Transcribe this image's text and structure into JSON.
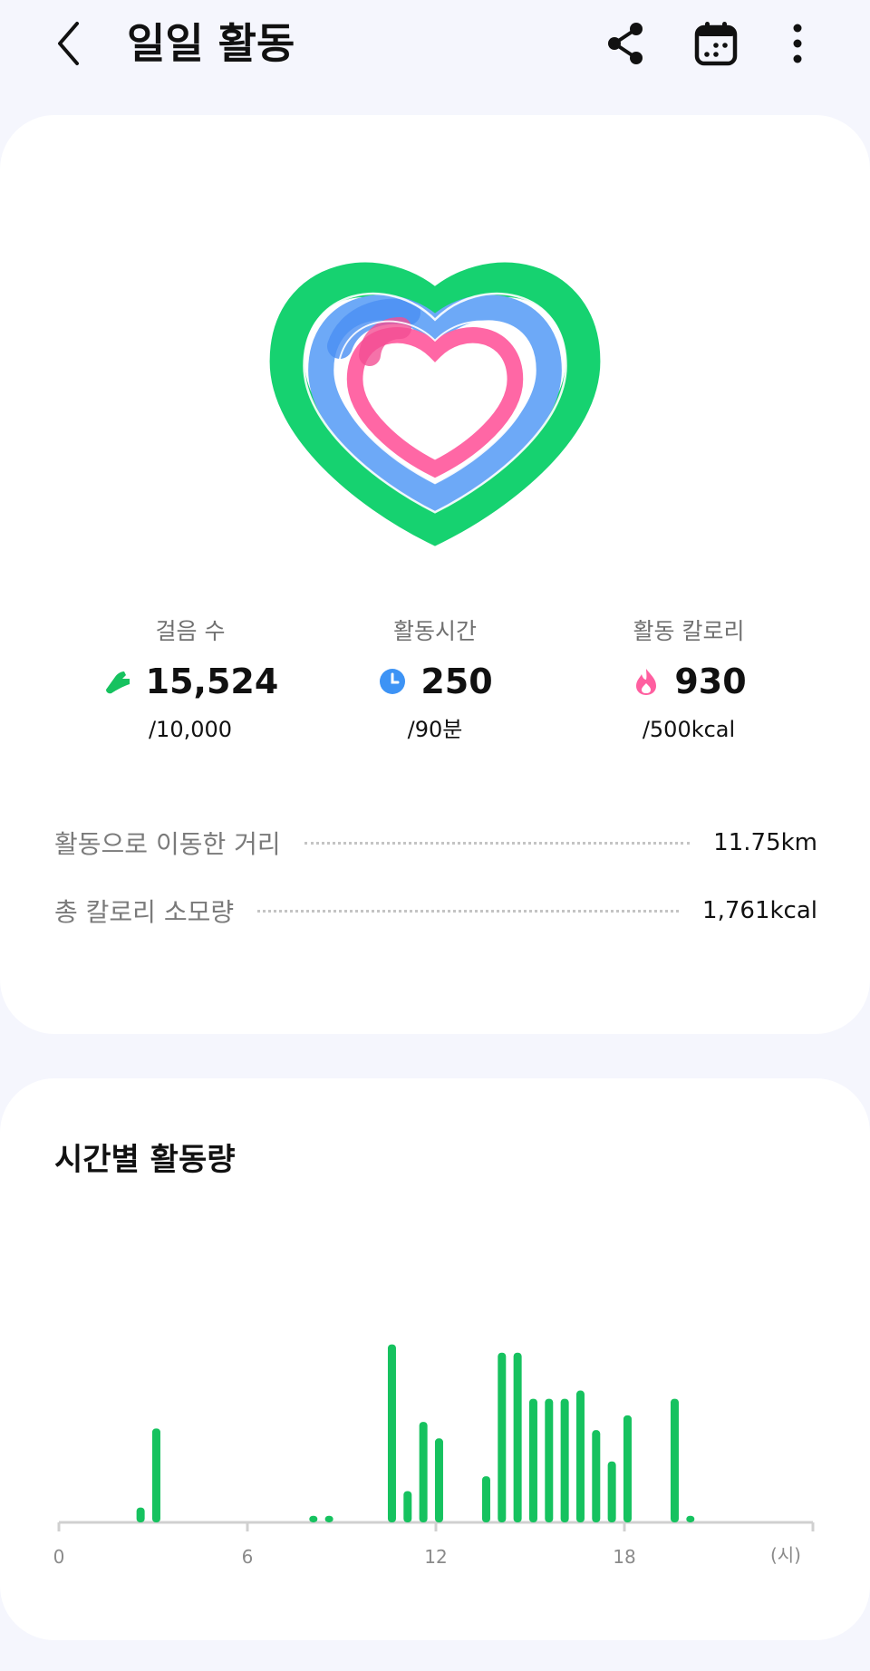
{
  "header": {
    "title": "일일 활동",
    "icons": [
      "back-arrow-icon",
      "share-icon",
      "calendar-icon",
      "more-vertical-icon"
    ]
  },
  "summary": {
    "metrics": [
      {
        "label": "걸음 수",
        "value": "15,524",
        "goal": "/10,000",
        "icon": "shoe-icon",
        "color": "#16c25f"
      },
      {
        "label": "활동시간",
        "value": "250",
        "goal": "/90분",
        "icon": "clock-icon",
        "color": "#3d93f5"
      },
      {
        "label": "활동 칼로리",
        "value": "930",
        "goal": "/500kcal",
        "icon": "flame-icon",
        "color": "#ff5fa0"
      }
    ],
    "stats": [
      {
        "label": "활동으로 이동한 거리",
        "value": "11.75km"
      },
      {
        "label": "총 칼로리 소모량",
        "value": "1,761kcal"
      }
    ]
  },
  "chart_data": {
    "type": "bar",
    "title": "시간별 활동량",
    "x_unit": "(시)",
    "x_ticks": [
      "0",
      "6",
      "12",
      "18"
    ],
    "xlim": [
      0,
      24
    ],
    "ylim": [
      0,
      11
    ],
    "color": "#16c25f",
    "x": [
      2.6,
      3.1,
      8.1,
      8.6,
      10.6,
      11.1,
      11.6,
      12.1,
      13.6,
      14.1,
      14.6,
      15.1,
      15.6,
      16.1,
      16.6,
      17.1,
      17.6,
      18.1,
      19.6,
      20.1
    ],
    "values": [
      0.9,
      5.7,
      0.4,
      0.4,
      10.8,
      1.9,
      6.1,
      5.1,
      2.8,
      10.3,
      10.3,
      7.5,
      7.5,
      7.5,
      8.0,
      5.6,
      3.7,
      6.5,
      7.5,
      0.4
    ]
  },
  "colors": {
    "ring_outer": "#16d270",
    "ring_middle": "#6da9f7",
    "ring_inner": "#ff67a5",
    "accent_green": "#16c25f"
  }
}
